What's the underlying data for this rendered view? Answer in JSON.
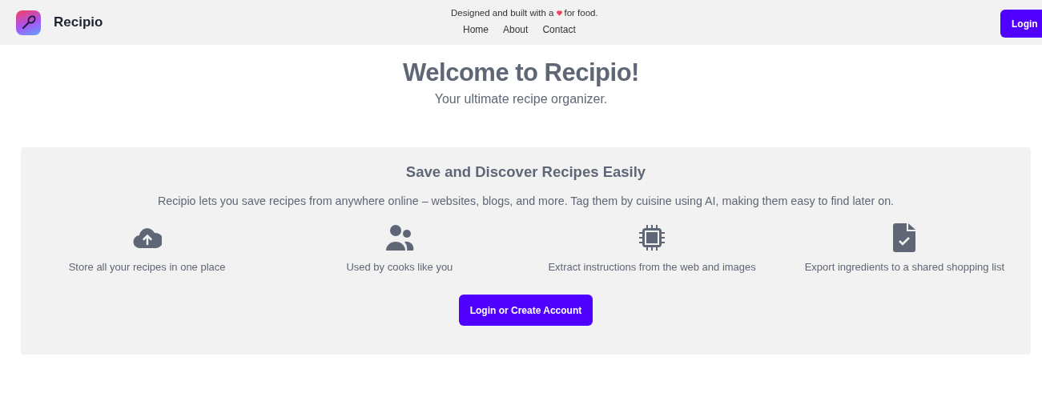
{
  "header": {
    "brand": "Recipio",
    "nav": [
      {
        "label": "Home"
      },
      {
        "label": "About"
      },
      {
        "label": "Contact"
      }
    ],
    "tagline": {
      "before": "Designed and built with a",
      "after": "for food."
    },
    "login": "Login"
  },
  "hero": {
    "title": "Welcome to Recipio!",
    "subtitle": "Your ultimate recipe organizer."
  },
  "card": {
    "title": "Save and Discover Recipes Easily",
    "text": "Recipio lets you save recipes from anywhere online – websites, blogs, and more. Tag them by cuisine using AI, making them easy to find later on.",
    "features": [
      {
        "kind": "cloud",
        "label": "Store all your recipes in one place"
      },
      {
        "kind": "users",
        "label": "Used by cooks like you"
      },
      {
        "kind": "chip",
        "label": "Extract instructions from the web and images"
      },
      {
        "kind": "doc",
        "label": "Export ingredients to a shared shopping list"
      }
    ],
    "button": "Login or Create Account"
  }
}
